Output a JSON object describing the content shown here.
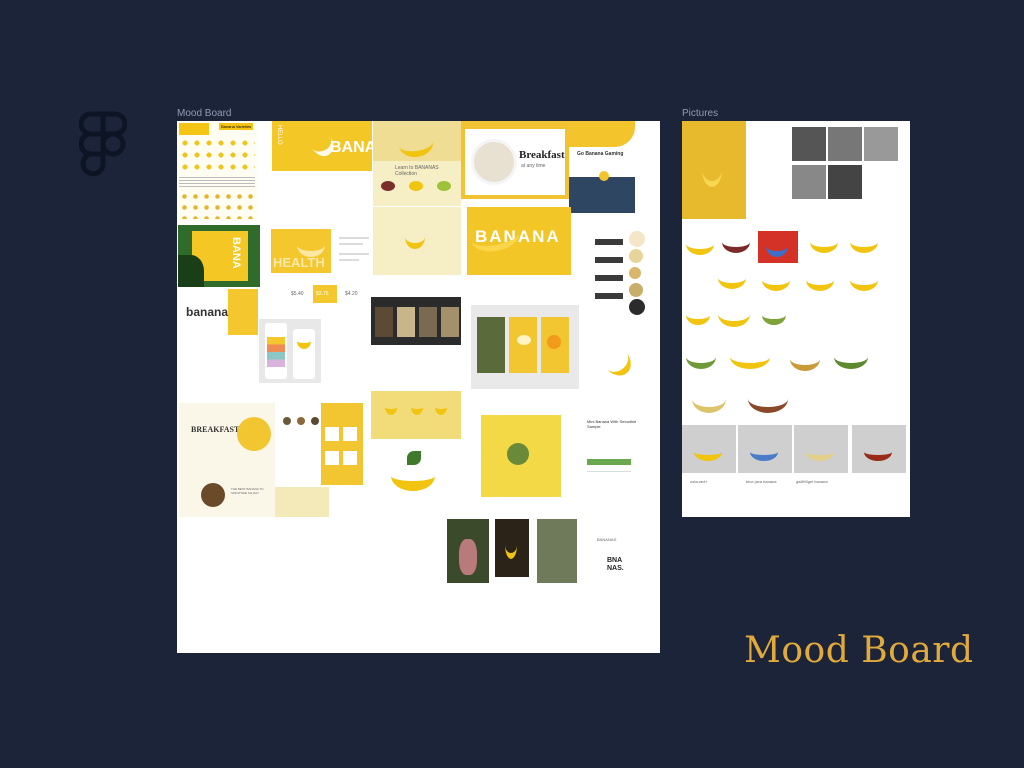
{
  "canvas": {
    "background": "#1c243a",
    "accent": "#e2a93b",
    "label_color": "#8f9bb3"
  },
  "app_logo": {
    "icon": "figma-logo-icon"
  },
  "frames": {
    "mood_board": {
      "label": "Mood Board"
    },
    "pictures": {
      "label": "Pictures"
    }
  },
  "mood_tiles": {
    "banana_chart": {
      "title": "Banana Varieties"
    },
    "hello_banana": {
      "big": "BANA",
      "vertical": "HELLO"
    },
    "yellow_banner": {
      "text": "Learn to BANANAS Collection"
    },
    "breakfast": {
      "title": "Breakfast",
      "sub": "at any time"
    },
    "game_ui": {
      "title": "Go Banana Gaming"
    },
    "banana_hero": {
      "title": "BANANA"
    },
    "health": {
      "word": "HEALTH"
    },
    "tropical_ad": {
      "word": "BANA"
    },
    "banana_word": {
      "word": "banana"
    },
    "swatches": {
      "colors": [
        "#f5e6c8",
        "#e8d49a",
        "#d9b66a",
        "#c9ae6b",
        "#2b2b2b"
      ]
    },
    "breakfast_site": {
      "title": "BREAKFAST!",
      "sub": "THE BEST BANANA TO SMOOTHIE SO DAY"
    },
    "shop_page": {
      "title": "Mini Banana With Smoothie Sample"
    },
    "logo_set": {
      "a": "BANANAS.",
      "b": "BNA",
      "c": "NAS."
    },
    "pricing": {
      "a": "$5.40",
      "b": "$3.75",
      "c": "$4.20"
    }
  },
  "pictures_tiles": {
    "captions": [
      "coloured+",
      "blue java banana",
      "ga8H0gei banana"
    ]
  },
  "footer": {
    "title": "Mood Board"
  }
}
